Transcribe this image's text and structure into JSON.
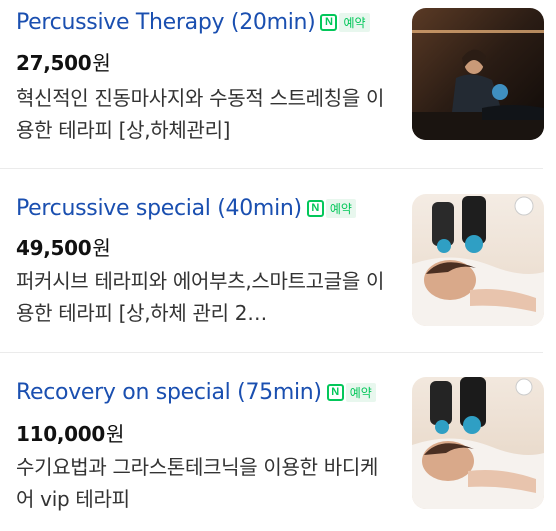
{
  "items": [
    {
      "title": "Percussive Therapy (20min)",
      "badge_label": "예약",
      "badge_icon": "naver-n-icon",
      "price": "27,500",
      "price_unit": "원",
      "description": "혁신적인 진동마사지와 수동적 스트레칭을 이용한 테라피 [상,하체관리]"
    },
    {
      "title": "Percussive special (40min)",
      "badge_label": "예약",
      "badge_icon": "naver-n-icon",
      "price": "49,500",
      "price_unit": "원",
      "description": "퍼커시브 테라피와 에어부츠,스마트고글을 이용한 테라피 [상,하체 관리 2…"
    },
    {
      "title": "Recovery on special (75min)",
      "badge_label": "예약",
      "badge_icon": "naver-n-icon",
      "price": "110,000",
      "price_unit": "원",
      "description": "수기요법과 그라스톤테크닉을 이용한 바디케어 vip 테라피"
    }
  ],
  "naver_glyph": "N",
  "colors": {
    "title": "#1a4fb0",
    "naver_green": "#03c75a",
    "badge_bg": "#e8f7ee"
  }
}
